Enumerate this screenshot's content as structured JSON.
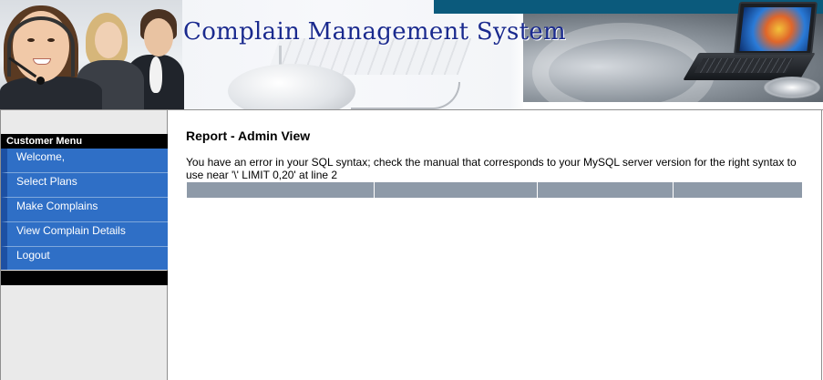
{
  "header": {
    "title": "Complain Management System"
  },
  "sidebar": {
    "heading": "Customer Menu",
    "items": [
      {
        "label": "Welcome,"
      },
      {
        "label": "Select Plans"
      },
      {
        "label": "Make Complains"
      },
      {
        "label": "View Complain Details"
      },
      {
        "label": "Logout"
      }
    ]
  },
  "main": {
    "title": "Report - Admin View",
    "error_message": "You have an error in your SQL syntax; check the manual that corresponds to your MySQL server version for the right syntax to use near '\\' LIMIT 0,20' at line 2"
  },
  "colors": {
    "menu_item": "#2f6fc6",
    "menu_accent": "#1d50a3",
    "title_blue": "#1a2a8e",
    "table_header": "#8e9aa8",
    "top_bar": "#0b5a7c"
  }
}
